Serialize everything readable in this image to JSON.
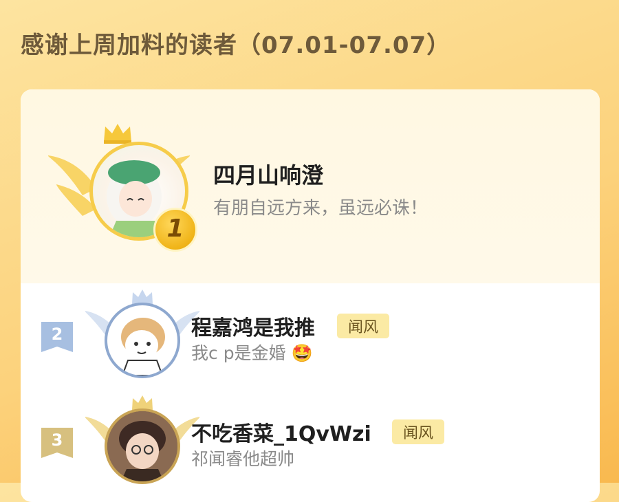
{
  "header": {
    "title": "感谢上周加料的读者（07.01-07.07）"
  },
  "colors": {
    "accent": "#fcd27c",
    "gold": "#f3b921",
    "tag_bg": "#fbeaa4"
  },
  "ranking": [
    {
      "rank": "1",
      "name": "四月山响澄",
      "message": "有朋自远方来，虽远必诛！",
      "tag": ""
    },
    {
      "rank": "2",
      "name": "程嘉鸿是我推",
      "message": "我c p是金婚",
      "emoji": "🤩",
      "tag": "闻风"
    },
    {
      "rank": "3",
      "name": "不吃香菜_1QvWzi",
      "message": "祁闻睿他超帅",
      "tag": "闻风"
    }
  ]
}
